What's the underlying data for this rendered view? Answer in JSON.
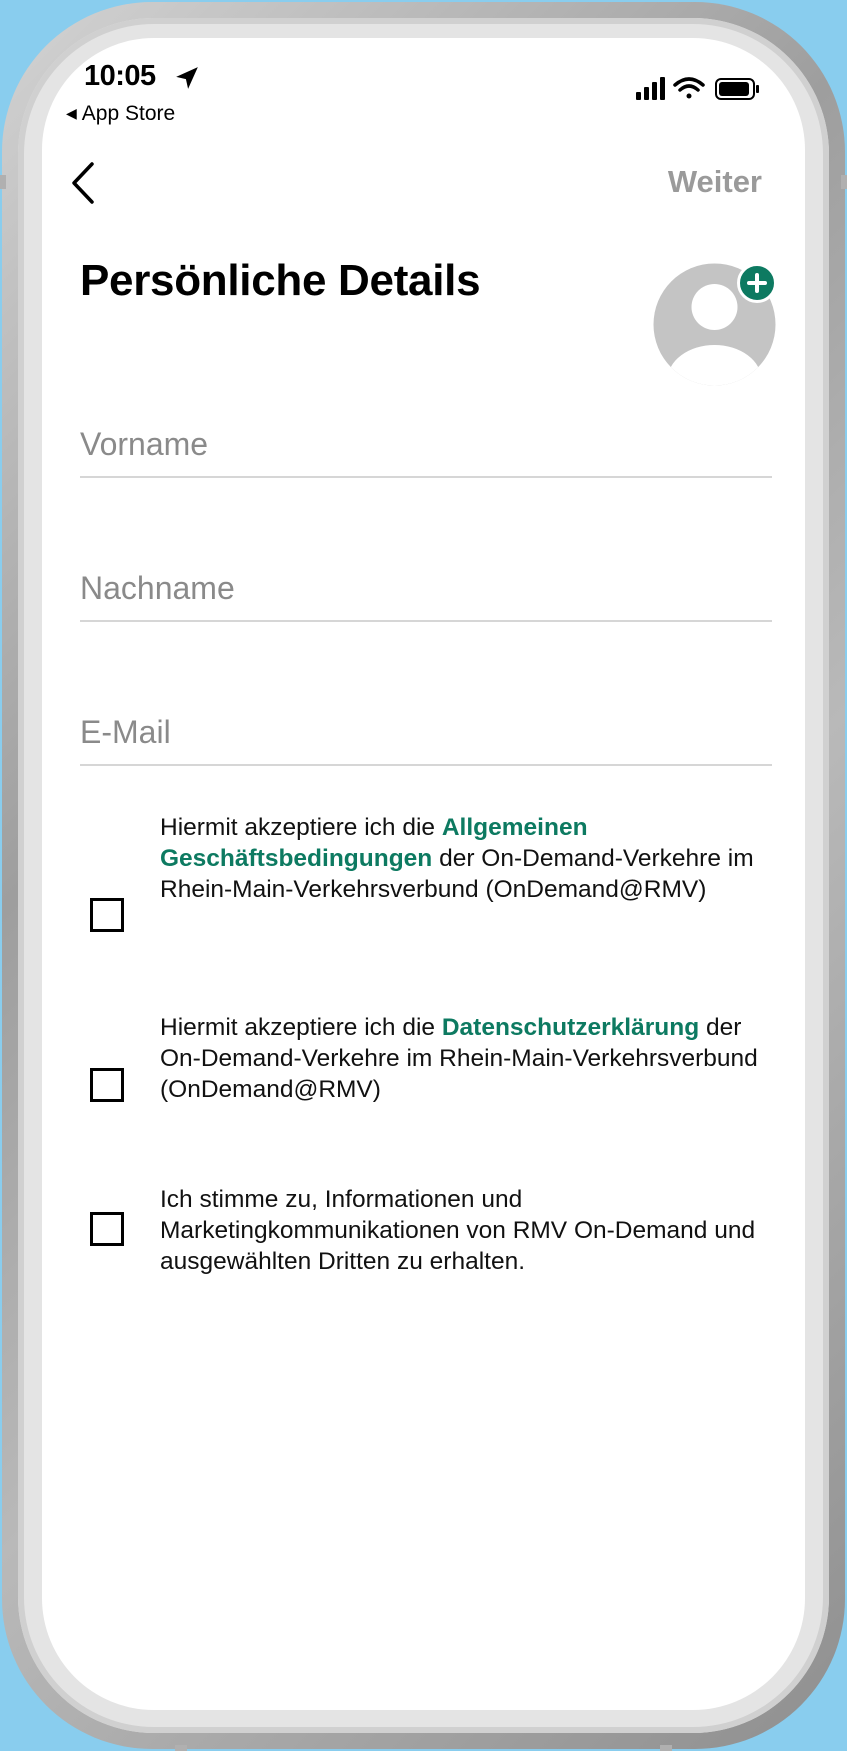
{
  "status_bar": {
    "time": "10:05",
    "back_app": "App Store",
    "icons": [
      "location-arrow-icon",
      "cellular-signal-icon",
      "wifi-icon",
      "battery-icon"
    ]
  },
  "nav": {
    "back_icon": "chevron-left-icon",
    "next_label": "Weiter",
    "next_color": "#9a9a9a"
  },
  "page": {
    "title": "Persönliche Details"
  },
  "avatar": {
    "icon": "person-placeholder-icon",
    "add_icon": "plus-icon",
    "accent": "#0d7a61"
  },
  "form": {
    "first_name": {
      "placeholder": "Vorname",
      "value": ""
    },
    "last_name": {
      "placeholder": "Nachname",
      "value": ""
    },
    "email": {
      "placeholder": "E-Mail",
      "value": ""
    }
  },
  "consents": [
    {
      "checked": false,
      "before": "Hiermit akzeptiere ich die ",
      "link": "Allgemeinen Geschäftsbedingungen",
      "after": " der On-Demand-Verkehre im Rhein-Main-Verkehrsverbund (OnDemand@RMV)"
    },
    {
      "checked": false,
      "before": "Hiermit akzeptiere ich die ",
      "link": "Datenschutzerklärung",
      "after": " der On-Demand-Verkehre im Rhein-Main-Verkehrsverbund (OnDemand@RMV)"
    },
    {
      "checked": false,
      "text": "Ich stimme zu, Informationen und Marketingkommunikationen von RMV On-Demand und ausgewählten Dritten zu erhalten."
    }
  ],
  "colors": {
    "link_green": "#0d7a61",
    "background_blue": "#89cdee"
  }
}
